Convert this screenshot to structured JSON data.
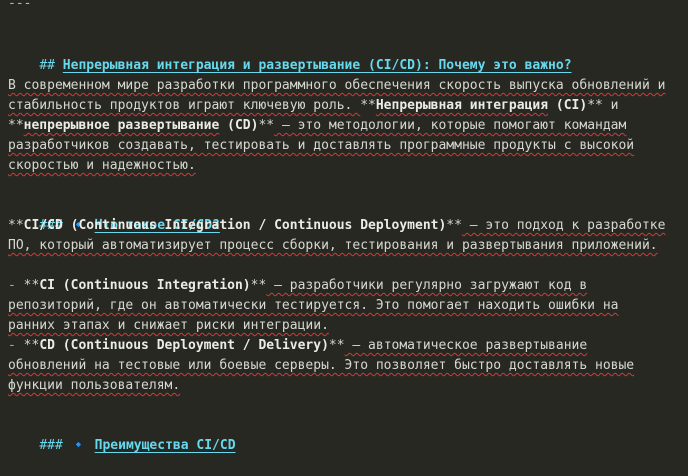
{
  "doc": {
    "hr": "---",
    "h2": {
      "marker": "##",
      "text": "Непрерывная интеграция и развертывание (CI/CD): Почему это важно?"
    },
    "p1": {
      "l1": "В современном мире разработки программного обеспечения скорость выпуска обновлений и",
      "l2_a": "стабильность продуктов играют ключевую роль. ",
      "l2_m1": "**",
      "l2_b": "Непрерывная интеграция",
      "l2_c": " (CI)",
      "l2_m2": "**",
      "l2_d": " и",
      "l3_m1": "**",
      "l3_b": "непрерывное развертывание",
      "l3_c": " (CD)",
      "l3_m2": "**",
      "l3_d": " — это методологии, которые помогают командам",
      "l4": "разработчиков создавать, тестировать и доставлять программные продукты с высокой",
      "l5": "скоростью и надежностью."
    },
    "h3a": {
      "marker": "###",
      "bullet": "🔹",
      "text": "Что такое CI/CD?"
    },
    "p2": {
      "l1_m1": "**",
      "l1_b": "CI/CD (Continuous Integration / Continuous Deployment)",
      "l1_m2": "**",
      "l1_c": " — это подход к разработке",
      "l2": "ПО, который автоматизирует процесс сборки, тестирования и развертывания приложений."
    },
    "li1": {
      "dash": "-",
      "m1": "**",
      "b": "CI (Continuous Integration)",
      "m2": "**",
      "c": " — разработчики регулярно загружают код в",
      "l2": "репозиторий, где он автоматически тестируется. Это помогает находить ошибки на",
      "l3": "ранних этапах и снижает риски интеграции."
    },
    "li2": {
      "dash": "-",
      "m1": "**",
      "b": "CD (Continuous Deployment / Delivery)",
      "m2": "**",
      "c": " — автоматическое развертывание",
      "l2": "обновлений на тестовые или боевые серверы. Это позволяет быстро доставлять новые",
      "l3": "функции пользователям."
    },
    "h3b": {
      "marker": "###",
      "bullet": "🔹",
      "text": "Преимущества CI/CD"
    }
  }
}
